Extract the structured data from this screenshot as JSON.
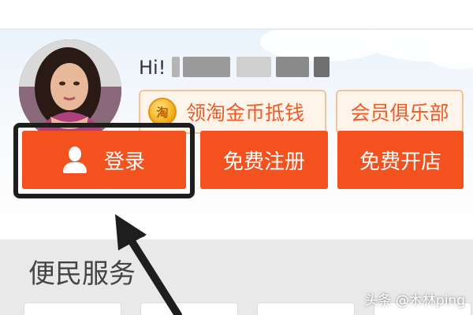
{
  "top_strip": {
    "partial_text": ""
  },
  "user": {
    "greeting": "Hi!"
  },
  "perks": {
    "coin_icon_label": "淘",
    "coin_label": "领淘金币抵钱",
    "club_label": "会员俱乐部"
  },
  "actions": {
    "login_label": "登录",
    "register_label": "免费注册",
    "open_shop_label": "免费开店"
  },
  "services": {
    "title": "便民服务"
  },
  "watermark": "头条 @木林ping",
  "colors": {
    "primary_button": "#f3521e",
    "pill_border": "#f3c39c",
    "pill_text": "#f05a24",
    "highlight": "#1e1e1e"
  },
  "icons": {
    "coin": "taobao-coin-icon",
    "login": "user-icon",
    "annotation": "pointer-arrow"
  }
}
